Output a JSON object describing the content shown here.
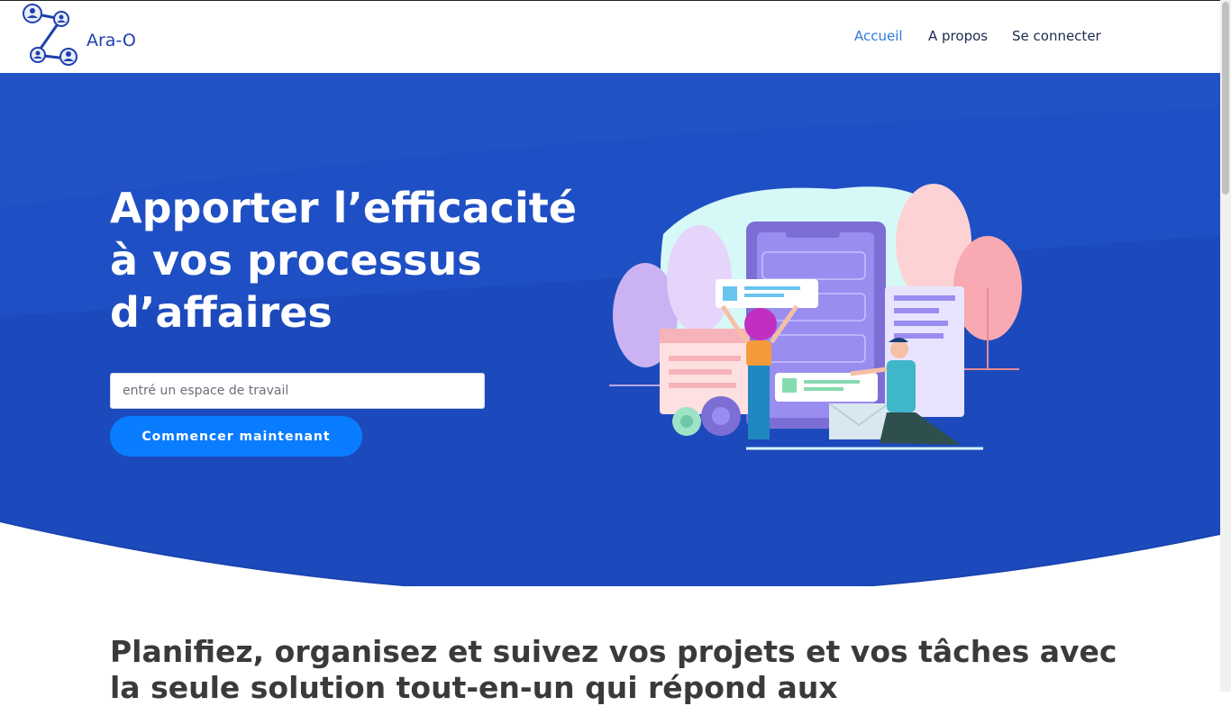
{
  "brand": {
    "name": "Ara-O"
  },
  "nav": {
    "items": [
      {
        "label": "Accueil",
        "active": true
      },
      {
        "label": "A propos",
        "active": false
      },
      {
        "label": "Se connecter",
        "active": false
      }
    ]
  },
  "hero": {
    "title": "Apporter l’efficacité à vos processus d’affaires",
    "workspace_placeholder": "entré un espace de travail",
    "cta_label": "Commencer maintenant"
  },
  "section": {
    "title": "Planifiez, organisez et suivez vos projets et vos tâches avec la seule solution tout-en-un qui répond aux"
  },
  "colors": {
    "hero_blue": "#1f4fc4",
    "cta_blue": "#0a7cff",
    "nav_active": "#2f7ad9",
    "nav_text": "#1b2a4e"
  }
}
